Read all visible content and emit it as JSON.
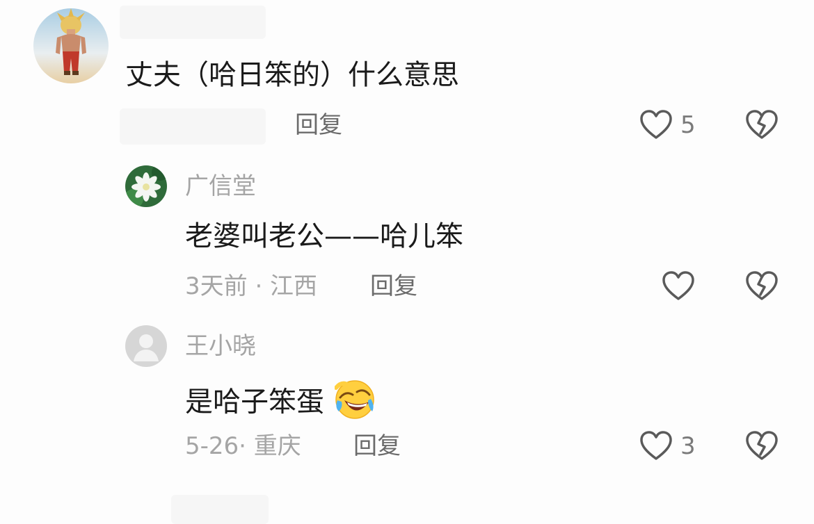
{
  "comments": [
    {
      "text": "丈夫（哈日笨的）什么意思",
      "reply_label": "回复",
      "like_count": "5",
      "avatar_icon": "anime-warrior-avatar"
    },
    {
      "username": "广信堂",
      "text": "老婆叫老公——哈儿笨",
      "meta": "3天前 · 江西",
      "reply_label": "回复",
      "like_count": "",
      "avatar_icon": "white-lotus-avatar"
    },
    {
      "username": "王小晓",
      "text": "是哈子笨蛋",
      "emoji": "laughing-crying-emoji",
      "meta": "5-26· 重庆",
      "reply_label": "回复",
      "like_count": "3",
      "avatar_icon": "default-user-avatar"
    }
  ],
  "colors": {
    "text_primary": "#1a1a1a",
    "text_secondary": "#a5a5a5",
    "reply": "#6b6b6b",
    "icon": "#5a5a5a",
    "background": "#fdfdfd"
  }
}
